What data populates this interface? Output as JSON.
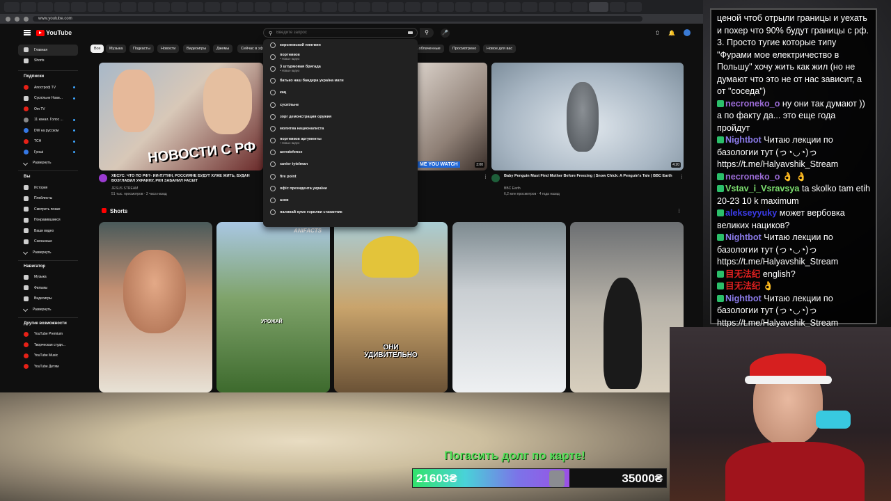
{
  "browser": {
    "url": "www.youtube.com"
  },
  "youtube": {
    "logo_text": "YouTube",
    "search": {
      "placeholder": "Введите запрос"
    },
    "sidebar": {
      "main": [
        "Главная",
        "Shorts"
      ],
      "subscriptions_title": "Подписки",
      "subscriptions": [
        {
          "label": "Апостроф TV",
          "color": "#c0392b"
        },
        {
          "label": "Суспільне Нови...",
          "color": "#e5e5e5"
        },
        {
          "label": "Om TV",
          "color": "#e62117"
        },
        {
          "label": "11 канал. Голос ...",
          "color": "#888888"
        },
        {
          "label": "DW на русском",
          "color": "#3578e5"
        },
        {
          "label": "ТСН",
          "color": "#e62117"
        },
        {
          "label": "Гроші",
          "color": "#3578e5"
        }
      ],
      "expand_label": "Развернуть",
      "you_title": "Вы",
      "you_items": [
        "История",
        "Плейлисты",
        "Смотреть позже",
        "Понравившиеся",
        "Ваши видео",
        "Скачанные",
        "Развернуть"
      ],
      "nav_title": "Навигатор",
      "nav_items": [
        "Музыка",
        "Фильмы",
        "Видеоигры",
        "Развернуть"
      ],
      "more_title": "Другие возможности",
      "more_items": [
        "YouTube Premium",
        "Творческая студи...",
        "YouTube Music",
        "YouTube Детям"
      ]
    },
    "chips": [
      {
        "label": "Все",
        "active": true
      },
      {
        "label": "Музыка"
      },
      {
        "label": "Подкасты"
      },
      {
        "label": "Новости"
      },
      {
        "label": "Видеоигры"
      },
      {
        "label": "Джемы"
      },
      {
        "label": "Сейчас в эф"
      },
      {
        "label": "...облаченные"
      },
      {
        "label": "Просмотрено"
      },
      {
        "label": "Новое для вас"
      }
    ],
    "suggestions": [
      {
        "text": "королевский пингвин"
      },
      {
        "text": "портников",
        "sub": "• Новые видео"
      },
      {
        "text": "3 штурмовая бригада",
        "sub": "• Новые видео"
      },
      {
        "text": "батько наш бандера україна мати"
      },
      {
        "text": "кац"
      },
      {
        "text": "суспільне"
      },
      {
        "text": "зорг демонстрация оружия"
      },
      {
        "text": "молитва националиста"
      },
      {
        "text": "портников аргументы",
        "sub": "• Новые видео"
      },
      {
        "text": "aerodefense"
      },
      {
        "text": "xavier tytelman"
      },
      {
        "text": "fire point"
      },
      {
        "text": "офіс президента україни"
      },
      {
        "text": "азов"
      },
      {
        "text": "наливай куме горилки стаканчик"
      }
    ],
    "videos": [
      {
        "thumb_text": "НОВОСТИ С РФ",
        "title": "ХЕСУС: ЧТО ПО РФ?- ИИ-ПУТИН, РОССИЯНЕ БУДУТ ХУЖЕ ЖИТЬ, БУДАН ВОЗГЛАВИЛ УКРАИНУ, РКН ЗАБАНИЛ FACEIT",
        "channel": "JESUS STREAM",
        "meta": "51 тыс. просмотров · 2 часа назад"
      },
      {
        "thumb_text": "ME YOU WATCH",
        "duration": "3:00"
      },
      {
        "title": "Baby Penguin Must Find Mother Before Freezing | Snow Chick: A Penguin's Tale | BBC Earth",
        "channel": "BBC Earth",
        "meta": "6,2 млн просмотров · 4 года назад",
        "duration": "4:20"
      }
    ],
    "shorts_title": "Shorts",
    "shorts": [
      {
        "caption": "",
        "tag": ""
      },
      {
        "caption": "УРОЖАЙ",
        "tag": "ANIFACTS"
      },
      {
        "caption": "ОНИ УДИВИТЕЛЬНО",
        "tag": ""
      },
      {
        "caption": "",
        "tag": ""
      },
      {
        "caption": "",
        "tag": ""
      }
    ]
  },
  "overlay": {
    "debt_label": "Погасить долг по карте!",
    "debt_current": "21603₴",
    "debt_goal": "35000₴",
    "debt_progress": 0.617
  },
  "chat": [
    {
      "user": "",
      "text": "ценой чтоб отрыли границы и уехать и похер что 90% будут границы с рф. 3. Просто тугие которые типу \"Фурами мое електричество в Польшу\" хочу жить как жил (но не думают что это не от нас зависит, а от \"соседа\")"
    },
    {
      "user": "necroneko_o",
      "user_color": "#9b6bd6",
      "text": "ну они так думают )) а по факту да... это еще года пройдут"
    },
    {
      "user": "Nightbot",
      "user_color": "#8a7ae8",
      "text": "Читаю лекции по базологии тут (っ◔◡◔)っ https://t.me/Halyavshik_Stream"
    },
    {
      "user": "necroneko_o",
      "user_color": "#9b6bd6",
      "text": "👌 👌"
    },
    {
      "user": "Vstav_i_Vsravsya",
      "user_color": "#7de070",
      "text": "ta skolko tam etih 20-23 10 k maximum"
    },
    {
      "user": "alekseyyuky",
      "user_color": "#3b3be8",
      "text": "может вербовка великих нациков?"
    },
    {
      "user": "Nightbot",
      "user_color": "#8a7ae8",
      "text": "Читаю лекции по базологии тут (っ◔◡◔)っ https://t.me/Halyavshik_Stream"
    },
    {
      "user": "目无法纪",
      "user_color": "#e02020",
      "text": "english?"
    },
    {
      "user": "目无法纪",
      "user_color": "#e02020",
      "text": "👌"
    },
    {
      "user": "Nightbot",
      "user_color": "#8a7ae8",
      "text": "Читаю лекции по базологии тут (っ◔◡◔)っ https://t.me/Halyavshik_Stream"
    }
  ]
}
